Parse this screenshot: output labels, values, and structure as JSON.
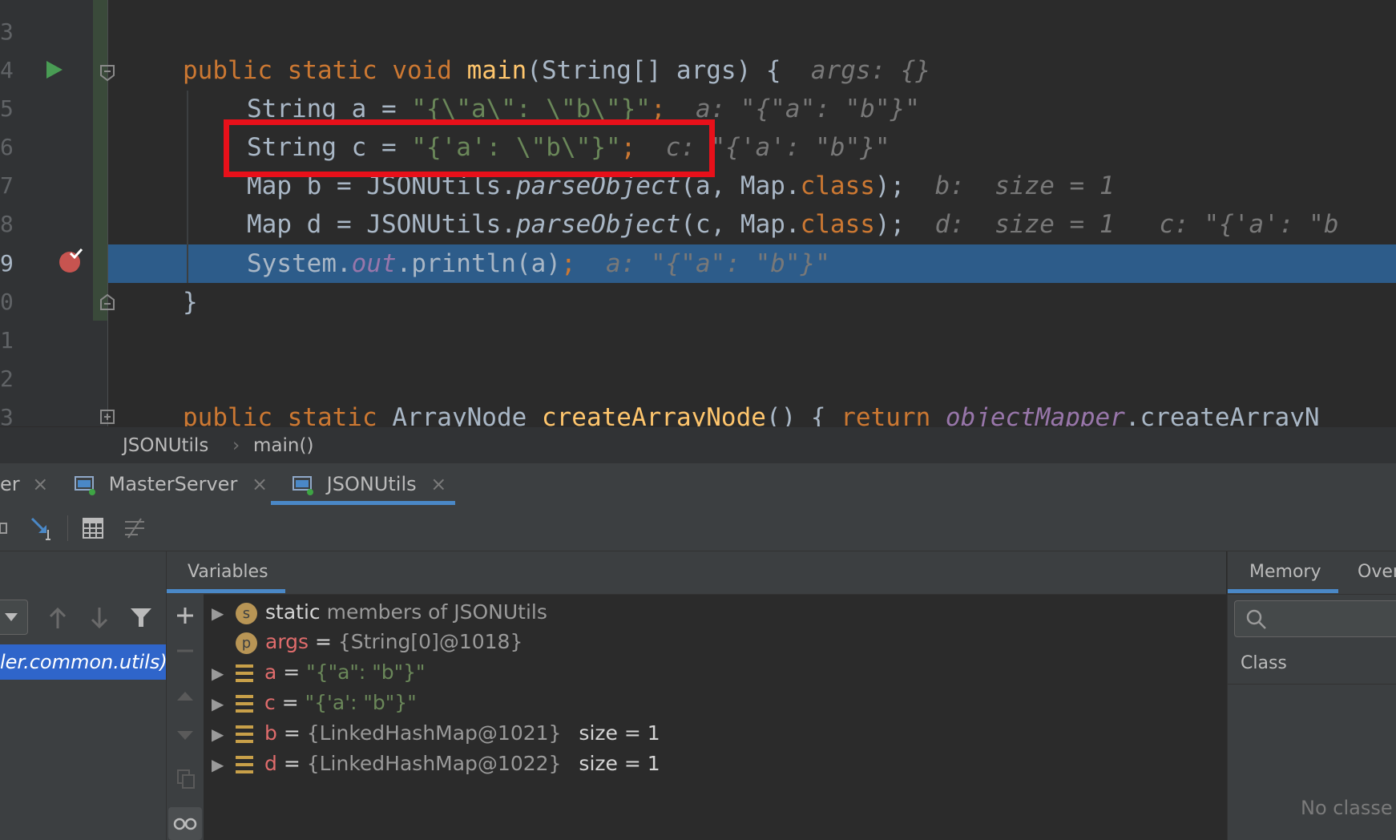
{
  "editor": {
    "line_numbers": [
      "3",
      "4",
      "5",
      "6",
      "7",
      "8",
      "9",
      "0",
      "1",
      "2",
      "3"
    ],
    "lines": {
      "main_sig": {
        "kw1": "public",
        "kw2": "static",
        "kw3": "void",
        "fn": "main",
        "rest": "(String[] args) {",
        "hint": "args: {}"
      },
      "line_a": {
        "pre": "String a = ",
        "str": "\"{\\\"a\\\": \\\"b\\\"}\"",
        "end": ";",
        "hint": "a: \"{\"a\": \"b\"}\""
      },
      "line_c": {
        "pre": "String c = ",
        "str": "\"{'a': \\\"b\\\"}\"",
        "end": ";",
        "hint": "c: \"{'a': \"b\"}\""
      },
      "line_b": {
        "pre": "Map b = JSONUtils.",
        "method": "parseObject",
        "args": "(a, Map.",
        "kw": "class",
        "end": ");",
        "hint": "b:  size = 1"
      },
      "line_d": {
        "pre": "Map d = JSONUtils.",
        "method": "parseObject",
        "args": "(c, Map.",
        "kw": "class",
        "end": ");",
        "hint": "d:  size = 1   c: \"{'a': \"b"
      },
      "line_print": {
        "pre": "System.",
        "field": "out",
        "rest": ".println(a)",
        "end": ";",
        "hint": "a: \"{\"a\": \"b\"}\""
      },
      "close_brace": "}",
      "create_sig": {
        "kw1": "public",
        "kw2": "static",
        "type": "ArrayNode",
        "fn": "createArrayNode",
        "rest": "() { ",
        "kw3": "return",
        "field": "objectMapper",
        "tail": ".createArrayN"
      }
    }
  },
  "breadcrumb": {
    "file": "JSONUtils",
    "sep": "›",
    "method": "main()"
  },
  "debug_tabs": [
    {
      "label": "er"
    },
    {
      "label": "MasterServer"
    },
    {
      "label": "JSONUtils"
    }
  ],
  "tab_close_glyph": "×",
  "frames": {
    "selected": "ler.common.utils)"
  },
  "variables": {
    "header": "Variables",
    "rows": [
      {
        "badge": "s",
        "name": "static",
        "value": "members of JSONUtils"
      },
      {
        "badge": "p",
        "name": "args",
        "eq": " = ",
        "value": "{String[0]@1018}"
      },
      {
        "name": "a",
        "eq": " = ",
        "value": "\"{\"a\": \"b\"}\""
      },
      {
        "name": "c",
        "eq": " = ",
        "value": "\"{'a': \"b\"}\""
      },
      {
        "name": "b",
        "eq": " = ",
        "value": "{LinkedHashMap@1021}",
        "extra": "size = 1"
      },
      {
        "name": "d",
        "eq": " = ",
        "value": "{LinkedHashMap@1022}",
        "extra": "size = 1"
      }
    ]
  },
  "memory": {
    "tab1": "Memory",
    "tab2": "Over",
    "class_col": "Class",
    "empty": "No classe"
  },
  "colors": {
    "accent": "#4a88c7",
    "highlight_box": "#e8101a",
    "exec_line": "#2d5c8a"
  }
}
